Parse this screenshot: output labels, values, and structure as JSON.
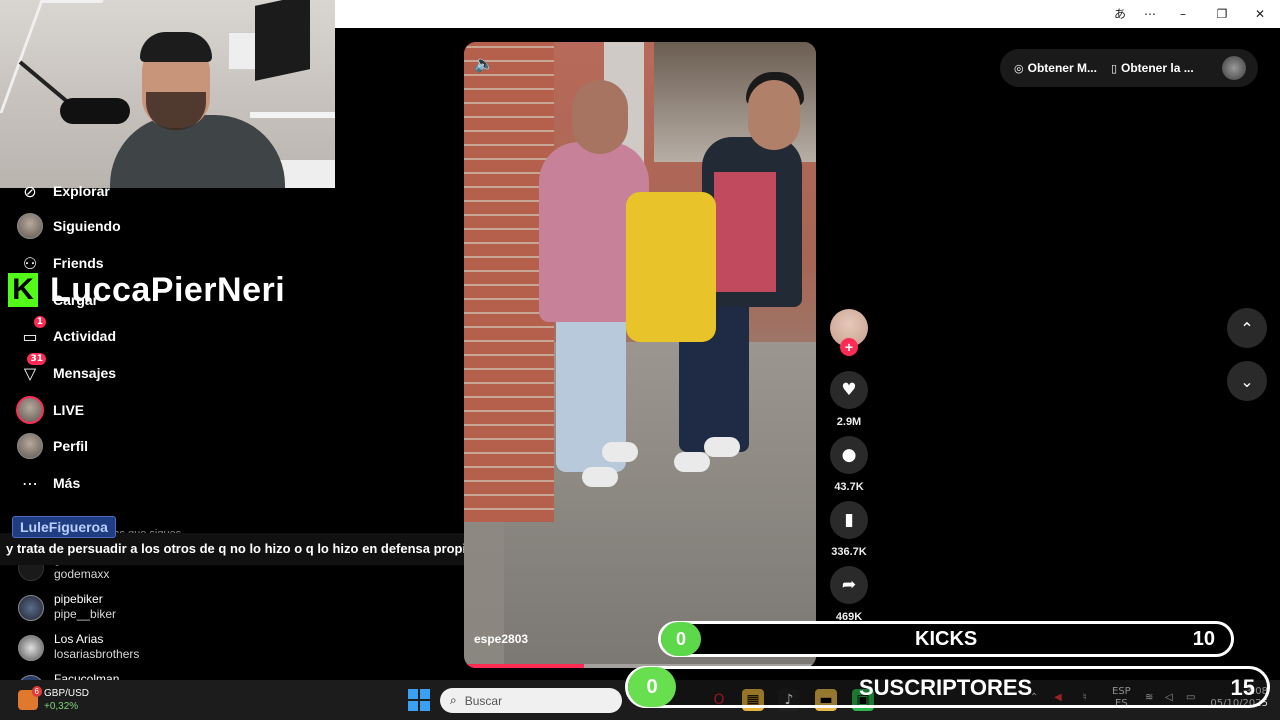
{
  "window": {
    "translate_icon": "translate-icon",
    "more_icon": "more-horizontal-icon",
    "minimize_icon": "minimize-icon",
    "restore_icon": "restore-icon",
    "close_icon": "close-icon"
  },
  "sidebar": {
    "items": [
      {
        "label": "Explorar",
        "icon": "compass-icon"
      },
      {
        "label": "Siguiendo",
        "icon": "following-avatar"
      },
      {
        "label": "Friends",
        "icon": "friends-icon"
      },
      {
        "label": "Cargar",
        "icon": "upload-icon"
      },
      {
        "label": "Actividad",
        "icon": "activity-icon",
        "badge": "1"
      },
      {
        "label": "Mensajes",
        "icon": "send-icon",
        "badge": "31"
      },
      {
        "label": "LIVE",
        "icon": "live-avatar"
      },
      {
        "label": "Perfil",
        "icon": "profile-avatar"
      },
      {
        "label": "Más",
        "icon": "more-icon"
      }
    ],
    "following_header": "Cuentas que sigues",
    "following": [
      {
        "display": "godemax",
        "handle": "godemaxx"
      },
      {
        "display": "pipebiker",
        "handle": "pipe__biker"
      },
      {
        "display": "Los Arias",
        "handle": "losariasbrothers"
      },
      {
        "display": "Facucolman",
        "handle": ""
      }
    ]
  },
  "overlay": {
    "brand_letter": "K",
    "streamer_name": "LuccaPierNeri",
    "chat_user": "LuleFigueroa",
    "chat_message": "y trata de persuadir a los otros de q no lo hizo o q lo hizo en defensa propia",
    "kicks_label": "KICKS",
    "kicks_current": "0",
    "kicks_goal": "10",
    "subs_label": "SUSCRIPTORES",
    "subs_current": "0",
    "subs_goal": "15"
  },
  "video": {
    "author": "espe2803",
    "progress": 0.34,
    "volume_icon": "volume-icon"
  },
  "actions": {
    "likes": "2.9M",
    "comments": "43.7K",
    "saves": "336.7K",
    "shares": "469K"
  },
  "top_pill": {
    "get_app_1": "Obtener M...",
    "get_app_2": "Obtener la ..."
  },
  "taskbar": {
    "widget_title": "GBP/USD",
    "widget_change": "+0,32%",
    "widget_badge": "6",
    "search_placeholder": "Buscar",
    "lang_1": "ESP",
    "lang_2": "ES",
    "time": "3:08",
    "date": "05/10/2025"
  },
  "colors": {
    "accent": "#fe2c55",
    "kick_green": "#53fc18",
    "goal_green": "#5dd84a"
  }
}
